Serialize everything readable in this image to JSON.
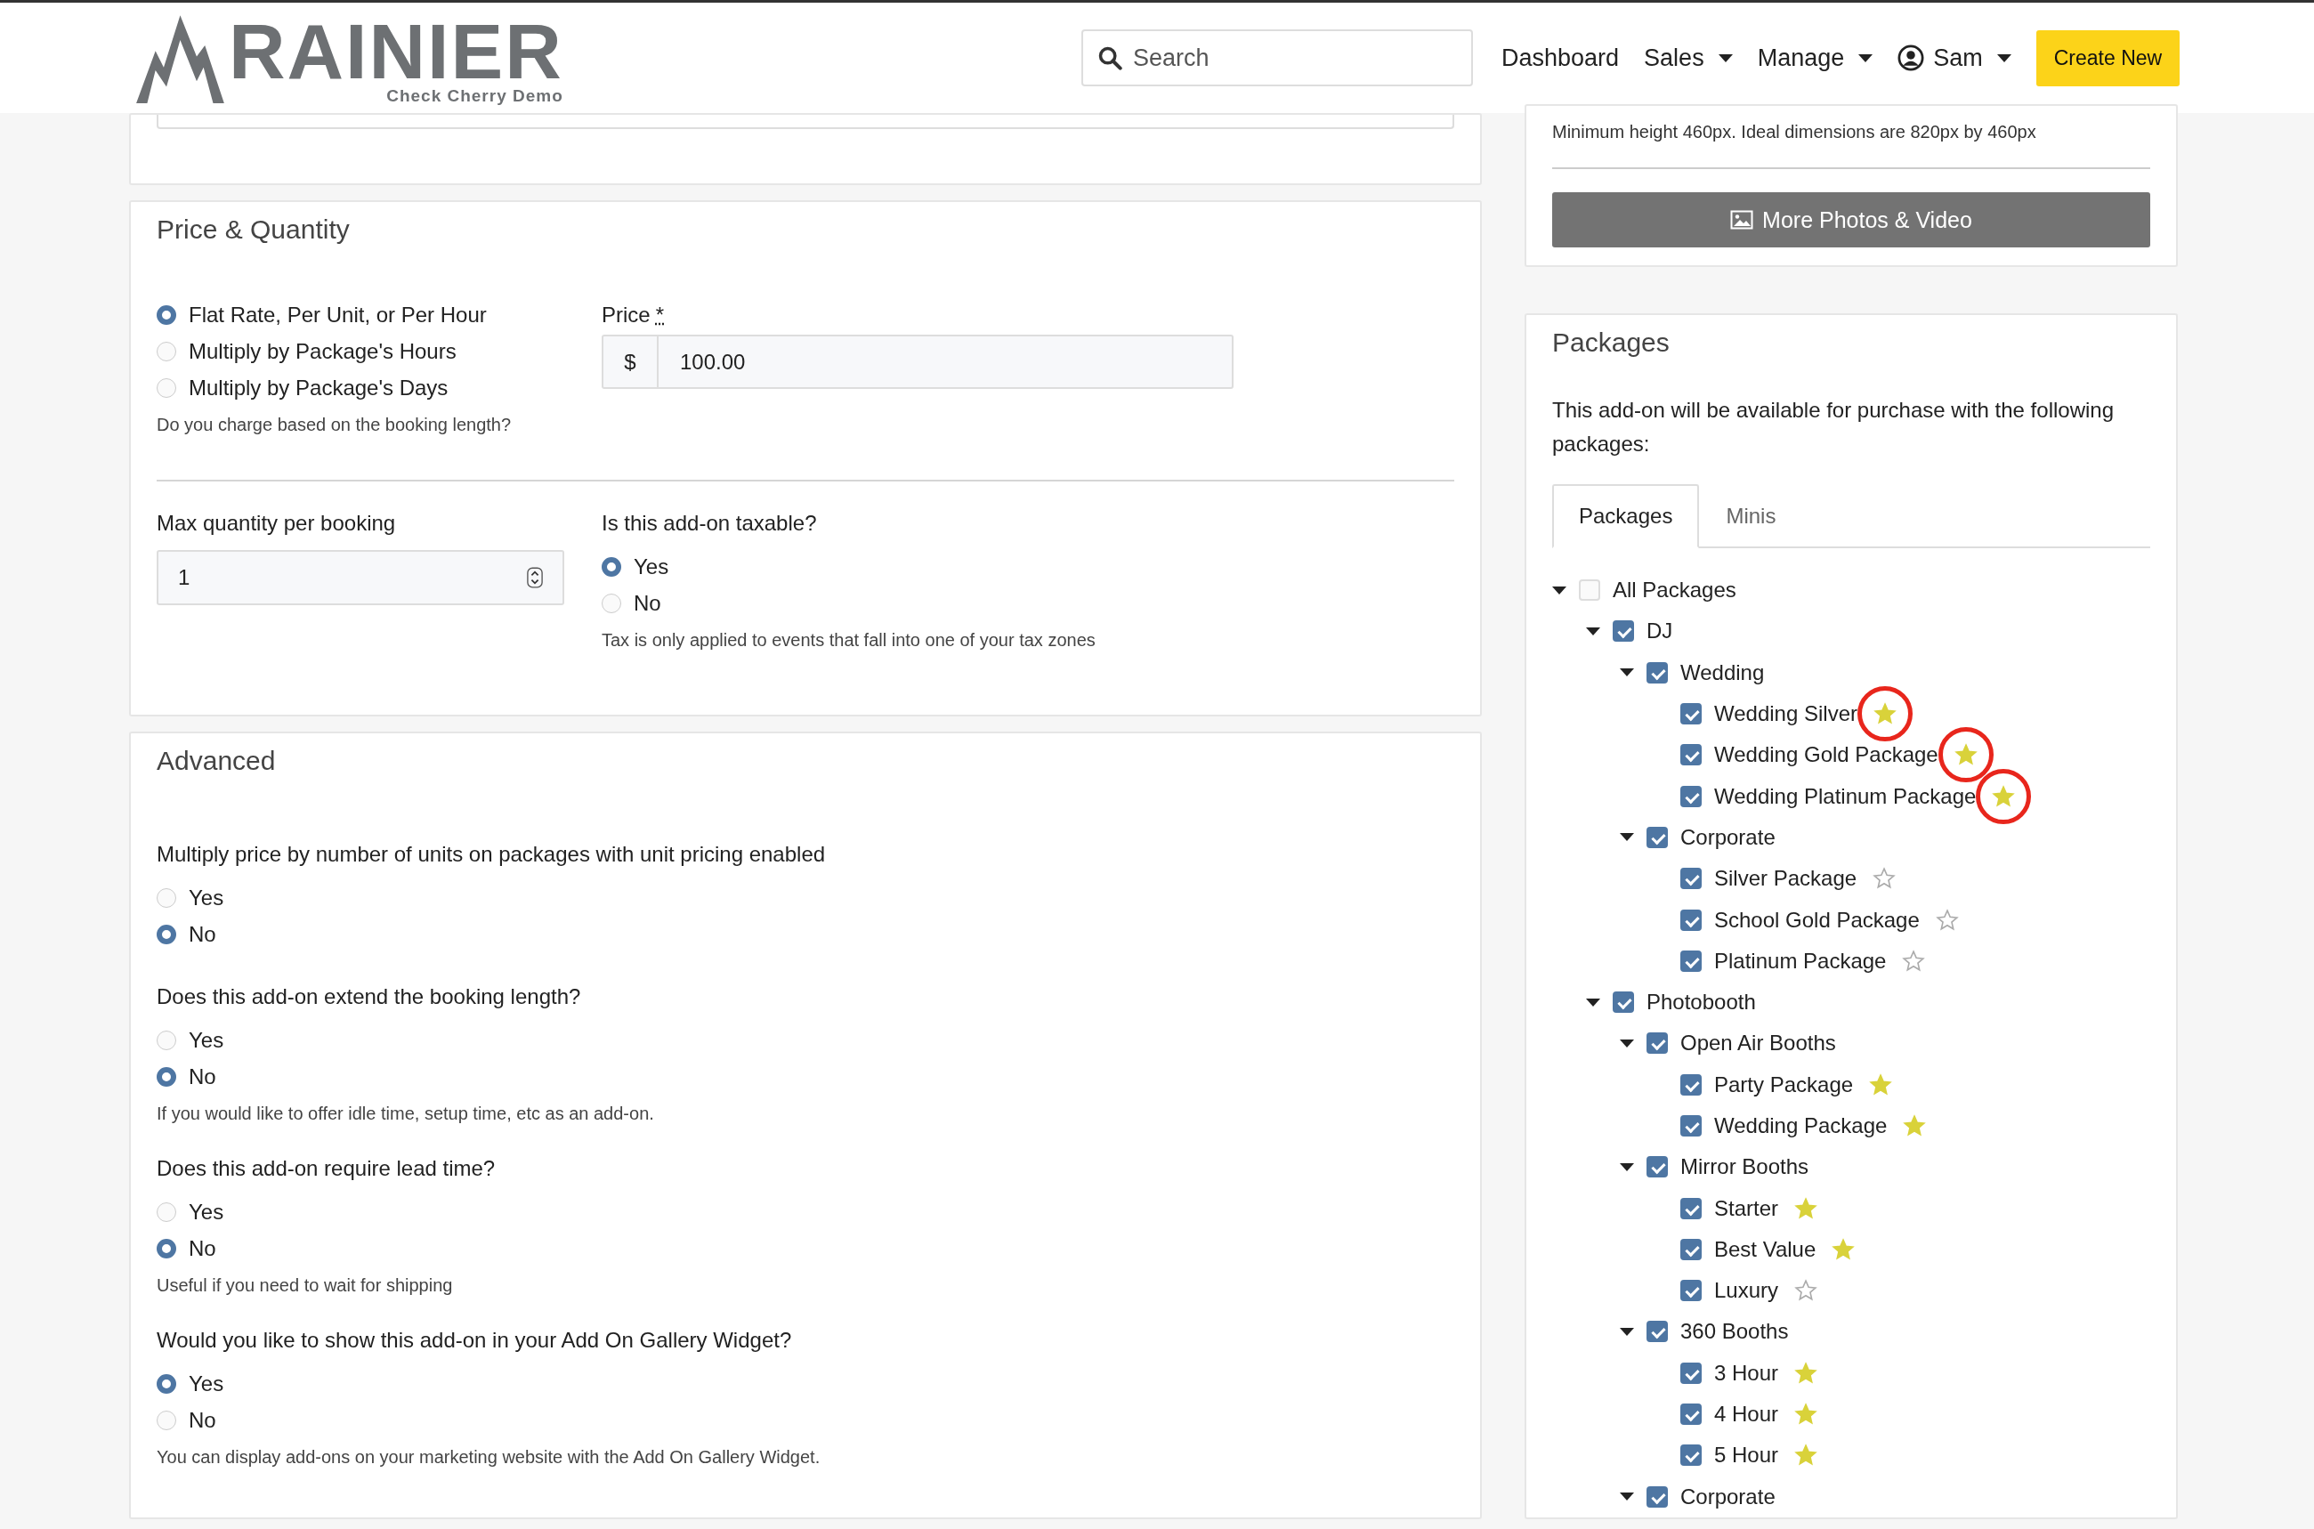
{
  "header": {
    "logo": {
      "name": "RAINIER",
      "tagline": "Check Cherry Demo"
    },
    "search": {
      "placeholder": "Search"
    },
    "nav": [
      {
        "label": "Dashboard",
        "dropdown": false
      },
      {
        "label": "Sales",
        "dropdown": true
      },
      {
        "label": "Manage",
        "dropdown": true
      },
      {
        "label": "Sam",
        "dropdown": true,
        "kind": "user"
      }
    ],
    "create_button": "Create New"
  },
  "photos": {
    "hint": "Minimum height 460px. Ideal dimensions are 820px by 460px",
    "button": "More Photos & Video"
  },
  "price_quantity": {
    "title": "Price & Quantity",
    "pricing_options": [
      {
        "label": "Flat Rate, Per Unit, or Per Hour",
        "selected": true
      },
      {
        "label": "Multiply by Package's Hours",
        "selected": false
      },
      {
        "label": "Multiply by Package's Days",
        "selected": false
      }
    ],
    "pricing_help": "Do you charge based on the booking length?",
    "price": {
      "label": "Price",
      "required_mark": "*",
      "prefix": "$",
      "value": "100.00"
    },
    "max_quantity": {
      "label": "Max quantity per booking",
      "value": "1"
    },
    "taxable": {
      "label": "Is this add-on taxable?",
      "options": [
        {
          "label": "Yes",
          "selected": true
        },
        {
          "label": "No",
          "selected": false
        }
      ],
      "help": "Tax is only applied to events that fall into one of your tax zones"
    }
  },
  "advanced": {
    "title": "Advanced",
    "questions": [
      {
        "label": "Multiply price by number of units on packages with unit pricing enabled",
        "options": [
          {
            "label": "Yes",
            "selected": false
          },
          {
            "label": "No",
            "selected": true
          }
        ]
      },
      {
        "label": "Does this add-on extend the booking length?",
        "options": [
          {
            "label": "Yes",
            "selected": false
          },
          {
            "label": "No",
            "selected": true
          }
        ],
        "help": "If you would like to offer idle time, setup time, etc as an add-on."
      },
      {
        "label": "Does this add-on require lead time?",
        "options": [
          {
            "label": "Yes",
            "selected": false
          },
          {
            "label": "No",
            "selected": true
          }
        ],
        "help": "Useful if you need to wait for shipping"
      },
      {
        "label": "Would you like to show this add-on in your Add On Gallery Widget?",
        "options": [
          {
            "label": "Yes",
            "selected": true
          },
          {
            "label": "No",
            "selected": false
          }
        ],
        "help": "You can display add-ons on your marketing website with the Add On Gallery Widget."
      }
    ]
  },
  "packages": {
    "title": "Packages",
    "description": "This add-on will be available for purchase with the following packages:",
    "tabs": [
      {
        "label": "Packages",
        "selected": true
      },
      {
        "label": "Minis",
        "selected": false
      }
    ],
    "tree": [
      {
        "label": "All Packages",
        "checked": false,
        "expanded": true,
        "children": [
          {
            "label": "DJ",
            "checked": true,
            "expanded": true,
            "children": [
              {
                "label": "Wedding",
                "checked": true,
                "expanded": true,
                "children": [
                  {
                    "label": "Wedding Silver",
                    "checked": true,
                    "featured": true,
                    "annotated": true
                  },
                  {
                    "label": "Wedding Gold Package",
                    "checked": true,
                    "featured": true,
                    "annotated": true
                  },
                  {
                    "label": "Wedding Platinum Package",
                    "checked": true,
                    "featured": true,
                    "annotated": true
                  }
                ]
              },
              {
                "label": "Corporate",
                "checked": true,
                "expanded": true,
                "children": [
                  {
                    "label": "Silver Package",
                    "checked": true,
                    "featured": false,
                    "annotated": false
                  },
                  {
                    "label": "School Gold Package",
                    "checked": true,
                    "featured": false,
                    "annotated": false
                  },
                  {
                    "label": "Platinum Package",
                    "checked": true,
                    "featured": false,
                    "annotated": false
                  }
                ]
              }
            ]
          },
          {
            "label": "Photobooth",
            "checked": true,
            "expanded": true,
            "children": [
              {
                "label": "Open Air Booths",
                "checked": true,
                "expanded": true,
                "children": [
                  {
                    "label": "Party Package",
                    "checked": true,
                    "featured": true,
                    "annotated": false
                  },
                  {
                    "label": "Wedding Package",
                    "checked": true,
                    "featured": true,
                    "annotated": false
                  }
                ]
              },
              {
                "label": "Mirror Booths",
                "checked": true,
                "expanded": true,
                "children": [
                  {
                    "label": "Starter",
                    "checked": true,
                    "featured": true,
                    "annotated": false
                  },
                  {
                    "label": "Best Value",
                    "checked": true,
                    "featured": true,
                    "annotated": false
                  },
                  {
                    "label": "Luxury",
                    "checked": true,
                    "featured": false,
                    "annotated": false
                  }
                ]
              },
              {
                "label": "360 Booths",
                "checked": true,
                "expanded": true,
                "children": [
                  {
                    "label": "3 Hour",
                    "checked": true,
                    "featured": true,
                    "annotated": false
                  },
                  {
                    "label": "4 Hour",
                    "checked": true,
                    "featured": true,
                    "annotated": false
                  },
                  {
                    "label": "5 Hour",
                    "checked": true,
                    "featured": true,
                    "annotated": false
                  }
                ]
              },
              {
                "label": "Corporate",
                "checked": true,
                "expanded": true
              }
            ]
          }
        ]
      }
    ]
  }
}
